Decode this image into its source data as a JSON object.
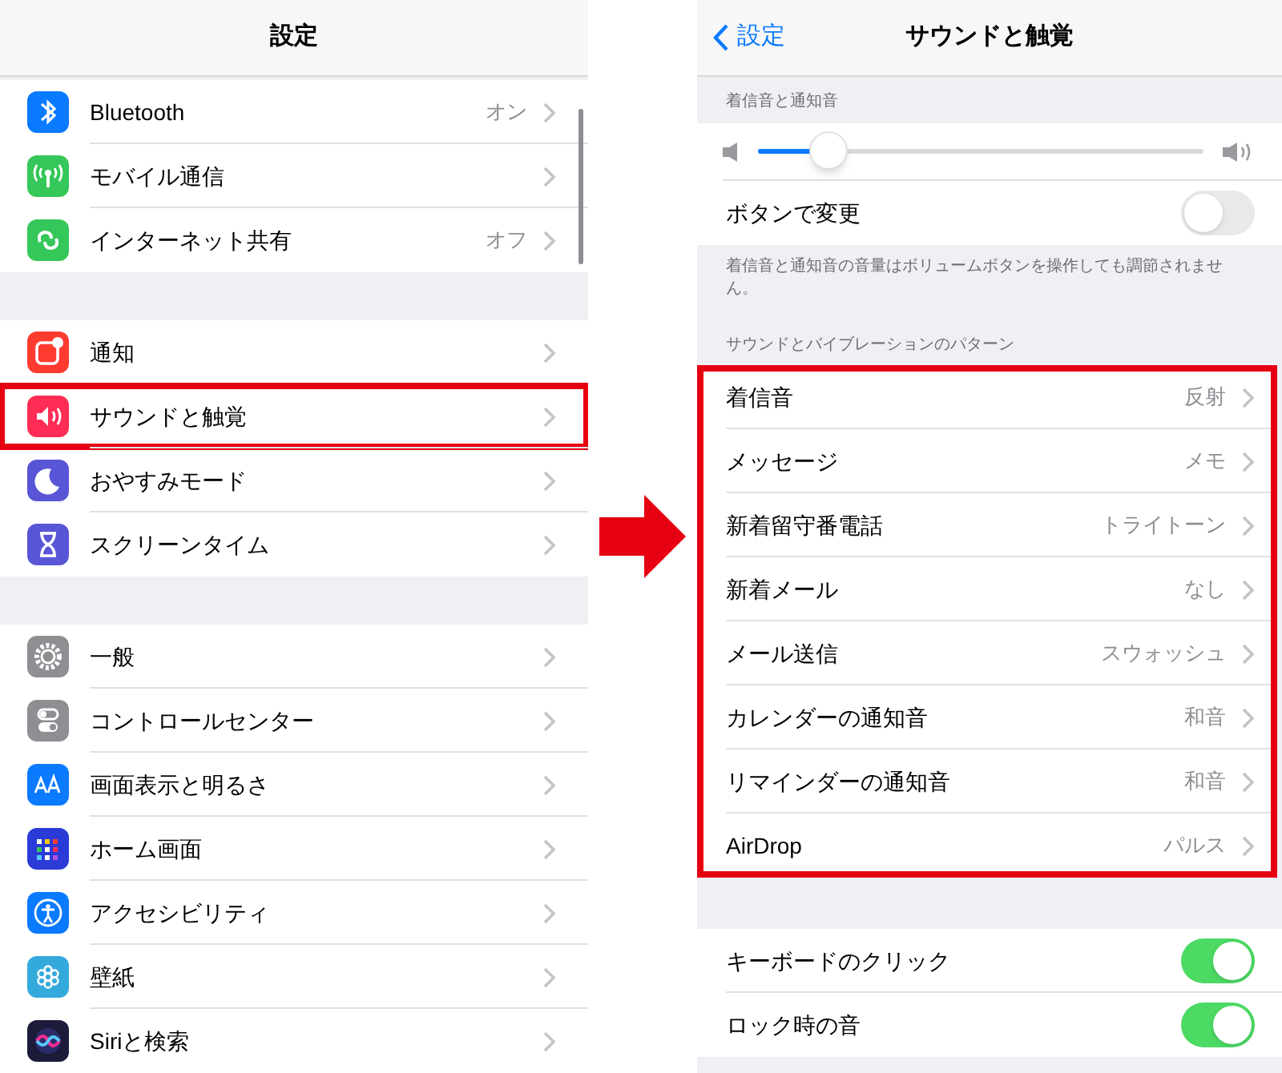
{
  "settings_screen": {
    "title": "設定",
    "groups": [
      {
        "rows": [
          {
            "kind": "bluetooth",
            "label": "Bluetooth",
            "value": "オン",
            "highlighted": false
          },
          {
            "kind": "cellular",
            "label": "モバイル通信",
            "highlighted": false
          },
          {
            "kind": "hotspot",
            "label": "インターネット共有",
            "value": "オフ",
            "highlighted": false
          }
        ]
      },
      {
        "rows": [
          {
            "kind": "notifications",
            "label": "通知",
            "highlighted": false
          },
          {
            "kind": "sound",
            "label": "サウンドと触覚",
            "highlighted": true
          },
          {
            "kind": "moon",
            "label": "おやすみモード",
            "highlighted": false
          },
          {
            "kind": "hourglass",
            "label": "スクリーンタイム",
            "highlighted": false
          }
        ]
      },
      {
        "rows": [
          {
            "kind": "gear",
            "label": "一般",
            "highlighted": false
          },
          {
            "kind": "switches",
            "label": "コントロールセンター",
            "highlighted": false
          },
          {
            "kind": "textsize",
            "label": "画面表示と明るさ",
            "highlighted": false
          },
          {
            "kind": "homegrid",
            "label": "ホーム画面",
            "highlighted": false
          },
          {
            "kind": "accessibility",
            "label": "アクセシビリティ",
            "highlighted": false
          },
          {
            "kind": "flower",
            "label": "壁紙",
            "highlighted": false
          },
          {
            "kind": "siri",
            "label": "Siriと検索",
            "highlighted": false
          }
        ]
      }
    ]
  },
  "sound_screen": {
    "back": "設定",
    "title": "サウンドと触覚",
    "ringer_section": {
      "header": "着信音と通知音",
      "volume": {
        "level": 0.16
      },
      "toggle": {
        "label": "ボタンで変更",
        "on": false
      },
      "footer": "着信音と通知音の音量はボリュームボタンを操作しても調節されません。"
    },
    "patterns_section": {
      "header": "サウンドとバイブレーションのパターン",
      "highlighted": true,
      "rows": [
        {
          "label": "着信音",
          "value": "反射"
        },
        {
          "label": "メッセージ",
          "value": "メモ"
        },
        {
          "label": "新着留守番電話",
          "value": "トライトーン"
        },
        {
          "label": "新着メール",
          "value": "なし"
        },
        {
          "label": "メール送信",
          "value": "スウォッシュ"
        },
        {
          "label": "カレンダーの通知音",
          "value": "和音"
        },
        {
          "label": "リマインダーの通知音",
          "value": "和音"
        },
        {
          "label": "AirDrop",
          "value": "パルス"
        }
      ]
    },
    "toggles": [
      {
        "label": "キーボードのクリック",
        "on": true
      },
      {
        "label": "ロック時の音",
        "on": true
      }
    ]
  }
}
